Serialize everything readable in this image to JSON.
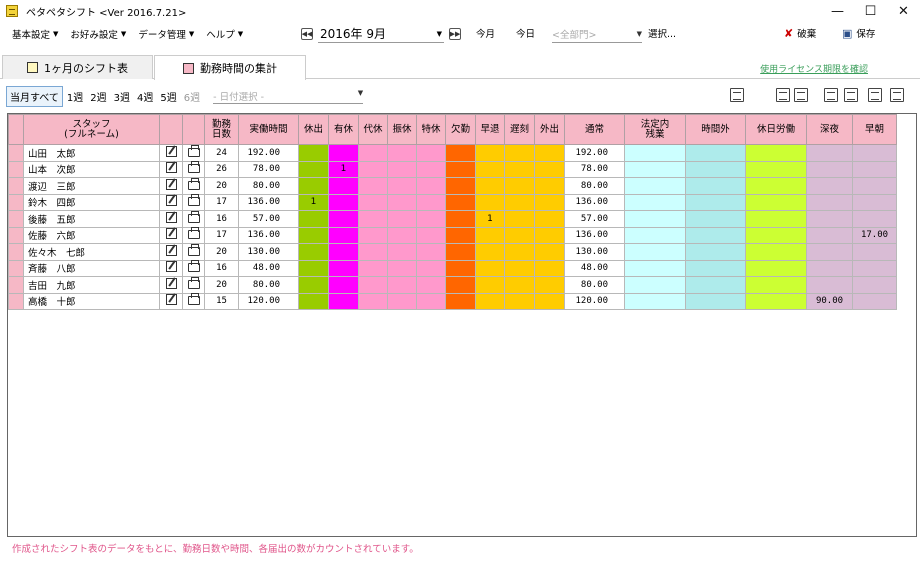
{
  "window": {
    "title": "ペタペタシフト <Ver 2016.7.21>"
  },
  "menu": {
    "items": [
      "基本設定",
      "お好み設定",
      "データ管理",
      "ヘルプ"
    ],
    "month": "2016年 9月",
    "this_month": "今月",
    "today": "今日",
    "dept_placeholder": "<全部門>",
    "select": "選択...",
    "discard": "破棄",
    "save": "保存"
  },
  "tabs": {
    "shift": "1ヶ月のシフト表",
    "hours": "勤務時間の集計"
  },
  "license_link": "使用ライセンス期限を確認",
  "weeks": {
    "all": "当月すべて",
    "items": [
      "1週",
      "2週",
      "3週",
      "4週",
      "5週",
      "6週"
    ],
    "date_placeholder": "- 日付選択 -"
  },
  "table": {
    "headers": {
      "staff": "スタッフ\n(フルネーム)",
      "days": "勤務\n日数",
      "actual": "実働時間",
      "kyushutsu": "休出",
      "yukyu": "有休",
      "daikyu": "代休",
      "furikyu": "振休",
      "tokkyu": "特休",
      "kekkin": "欠勤",
      "sotai": "早退",
      "chikoku": "遅刻",
      "gaishutsu": "外出",
      "normal": "通常",
      "legal_ot": "法定内\n残業",
      "overtime": "時間外",
      "holiday": "休日労働",
      "late_night": "深夜",
      "early_morning": "早朝"
    },
    "rows": [
      {
        "name": "山田　太郎",
        "days": "24",
        "actual": "192.00",
        "kyushutsu": "",
        "yukyu": "",
        "sotai": "",
        "normal": "192.00",
        "late_night": "",
        "early_morning": ""
      },
      {
        "name": "山本　次郎",
        "days": "26",
        "actual": "78.00",
        "kyushutsu": "",
        "yukyu": "1",
        "sotai": "",
        "normal": "78.00",
        "late_night": "",
        "early_morning": ""
      },
      {
        "name": "渡辺　三郎",
        "days": "20",
        "actual": "80.00",
        "kyushutsu": "",
        "yukyu": "",
        "sotai": "",
        "normal": "80.00",
        "late_night": "",
        "early_morning": ""
      },
      {
        "name": "鈴木　四郎",
        "days": "17",
        "actual": "136.00",
        "kyushutsu": "1",
        "yukyu": "",
        "sotai": "",
        "normal": "136.00",
        "late_night": "",
        "early_morning": ""
      },
      {
        "name": "後藤　五郎",
        "days": "16",
        "actual": "57.00",
        "kyushutsu": "",
        "yukyu": "",
        "sotai": "1",
        "normal": "57.00",
        "late_night": "",
        "early_morning": ""
      },
      {
        "name": "佐藤　六郎",
        "days": "17",
        "actual": "136.00",
        "kyushutsu": "",
        "yukyu": "",
        "sotai": "",
        "normal": "136.00",
        "late_night": "",
        "early_morning": "17.00"
      },
      {
        "name": "佐々木　七郎",
        "days": "20",
        "actual": "130.00",
        "kyushutsu": "",
        "yukyu": "",
        "sotai": "",
        "normal": "130.00",
        "late_night": "",
        "early_morning": ""
      },
      {
        "name": "斉藤　八郎",
        "days": "16",
        "actual": "48.00",
        "kyushutsu": "",
        "yukyu": "",
        "sotai": "",
        "normal": "48.00",
        "late_night": "",
        "early_morning": ""
      },
      {
        "name": "吉田　九郎",
        "days": "20",
        "actual": "80.00",
        "kyushutsu": "",
        "yukyu": "",
        "sotai": "",
        "normal": "80.00",
        "late_night": "",
        "early_morning": ""
      },
      {
        "name": "高橋　十郎",
        "days": "15",
        "actual": "120.00",
        "kyushutsu": "",
        "yukyu": "",
        "sotai": "",
        "normal": "120.00",
        "late_night": "90.00",
        "early_morning": ""
      }
    ]
  },
  "status_text": "作成されたシフト表のデータをもとに、勤務日数や時間、各届出の数がカウントされています。",
  "colors": {
    "header_bg": "#f6b8c6",
    "kyushutsu": "#99cc00",
    "yukyu": "#ff00ff",
    "leave_pink": "#ff99cc",
    "kekkin": "#ff6600",
    "early_late": "#ffcc00",
    "legal_ot": "#ccffff",
    "overtime": "#aeebeb",
    "holiday": "#ccff33",
    "night_morning": "#d9bcd5",
    "status_text": "#e0558a",
    "license_link": "#3a9e5a"
  }
}
